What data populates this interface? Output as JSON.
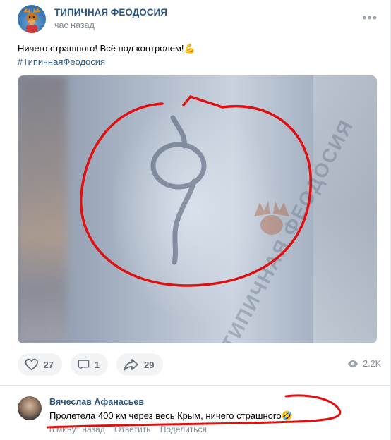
{
  "post": {
    "group_name": "ТИПИЧНАЯ ФЕОДОСИЯ",
    "time": "час назад",
    "more_label": "•••",
    "text": "Ничего страшного! Всё под контролем!💪",
    "hashtag": "#ТипичнаяФеодосия",
    "watermark": "ТИПИЧНАЯ ФЕОДОСИЯ",
    "icons": [
      "heart-icon",
      "comment-icon",
      "share-icon",
      "eye-icon"
    ]
  },
  "actions": {
    "likes": "27",
    "comments": "1",
    "shares": "29",
    "views": "2.2K"
  },
  "comment": {
    "author": "Вячеслав Афанасьев",
    "text": "Пролетела 400 км через весь Крым, ничего страшного🤣",
    "time": "8 минут назад",
    "reply_label": "Ответить",
    "share_label": "Поделиться"
  },
  "colors": {
    "link": "#2a5885",
    "annotation_red": "#e01010",
    "secondary_text": "#818c99",
    "button_bg": "#f2f3f5"
  }
}
